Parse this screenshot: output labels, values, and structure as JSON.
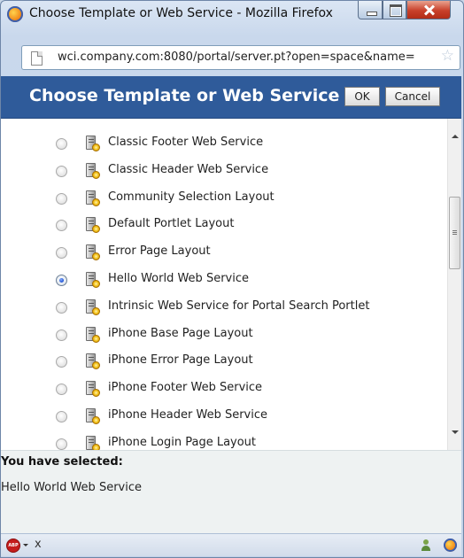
{
  "window": {
    "title": "Choose Template or Web Service - Mozilla Firefox"
  },
  "address_bar": {
    "url": "wci.company.com:8080/portal/server.pt?open=space&name="
  },
  "dialog": {
    "title": "Choose Template or Web Service",
    "ok_label": "OK",
    "cancel_label": "Cancel",
    "items": [
      {
        "label": "Classic Footer Web Service",
        "selected": false
      },
      {
        "label": "Classic Header Web Service",
        "selected": false
      },
      {
        "label": "Community Selection Layout",
        "selected": false
      },
      {
        "label": "Default Portlet Layout",
        "selected": false
      },
      {
        "label": "Error Page Layout",
        "selected": false
      },
      {
        "label": "Hello World Web Service",
        "selected": true
      },
      {
        "label": "Intrinsic Web Service for Portal Search Portlet",
        "selected": false
      },
      {
        "label": "iPhone Base Page Layout",
        "selected": false
      },
      {
        "label": "iPhone Error Page Layout",
        "selected": false
      },
      {
        "label": "iPhone Footer Web Service",
        "selected": false
      },
      {
        "label": "iPhone Header Web Service",
        "selected": false
      },
      {
        "label": "iPhone Login Page Layout",
        "selected": false
      }
    ],
    "selected_heading": "You have selected:",
    "selected_value": "Hello World Web Service"
  },
  "status_bar": {
    "adblock_label": "ABP",
    "close_label": "x"
  },
  "icons": {
    "window": "firefox-icon",
    "page": "page-icon",
    "bookmark": "star-icon",
    "item": "server-gear-icon",
    "adblock": "adblock-plus-icon",
    "status_people": "people-icon",
    "status_firefox": "firefox-icon"
  }
}
